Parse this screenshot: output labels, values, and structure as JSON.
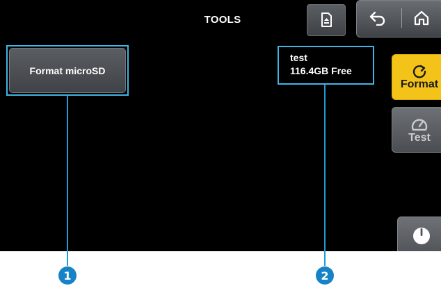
{
  "screen": {
    "title": "TOOLS"
  },
  "toolbar": {
    "eject_icon": "eject-icon",
    "back_icon": "back-arrow-icon",
    "home_icon": "home-icon"
  },
  "main": {
    "format_button_label": "Format microSD",
    "card_name": "test",
    "card_free": "116.4GB Free"
  },
  "side": {
    "format_label": "Format",
    "format_icon": "refresh-icon",
    "test_label": "Test",
    "test_icon": "gauge-icon",
    "power_icon": "power-icon"
  },
  "callouts": [
    "1",
    "2"
  ],
  "colors": {
    "accent_yellow": "#f3c319",
    "highlight_blue": "#3fb6e6",
    "callout_blue": "#1683c7"
  }
}
